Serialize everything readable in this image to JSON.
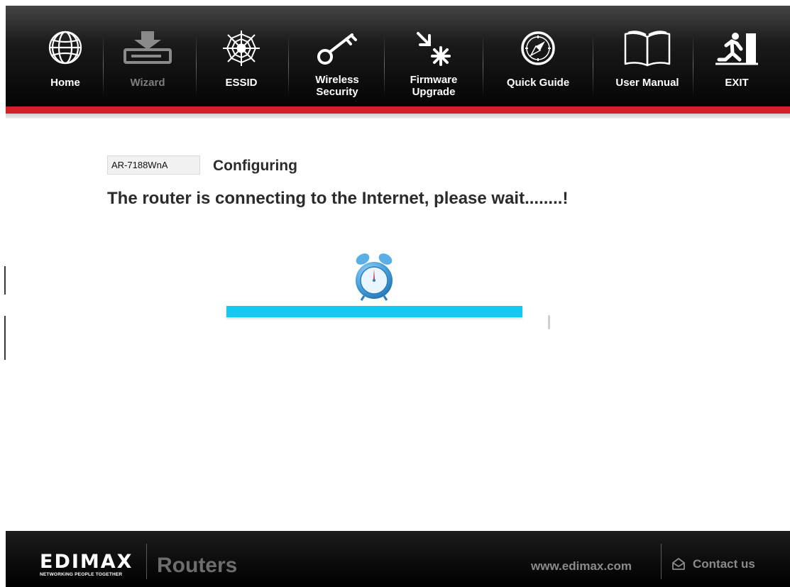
{
  "nav": {
    "home": "Home",
    "wizard": "Wizard",
    "essid": "ESSID",
    "wireless_security_1": "Wireless",
    "wireless_security_2": "Security",
    "firmware_upgrade_1": "Firmware",
    "firmware_upgrade_2": "Upgrade",
    "quick_guide": "Quick Guide",
    "user_manual": "User Manual",
    "exit": "EXIT"
  },
  "content": {
    "model": "AR-7188WnA",
    "config_label": "Configuring",
    "status_message": "The router is connecting to the Internet, please wait........!",
    "progress_fraction": 0.91
  },
  "footer": {
    "brand": "EDIMAX",
    "tagline": "NETWORKING PEOPLE TOGETHER",
    "product": "Routers",
    "website": "www.edimax.com",
    "contact": "Contact us"
  },
  "colors": {
    "accent_red": "#d3202b",
    "progress": "#12c9ef",
    "clock_blue": "#4aa3de"
  }
}
